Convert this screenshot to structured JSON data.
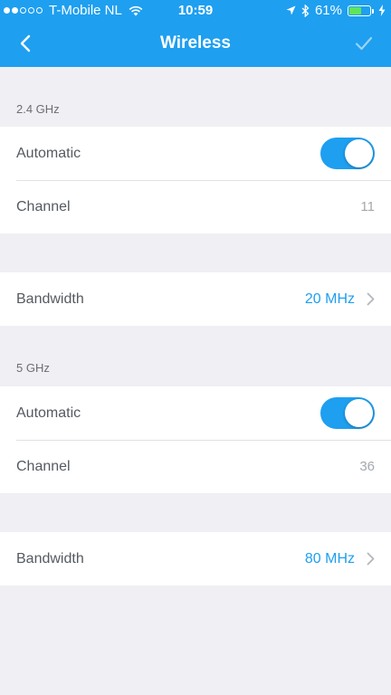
{
  "status_bar": {
    "carrier": "T-Mobile NL",
    "time": "10:59",
    "battery_percent": "61%",
    "battery_level": 0.61,
    "icons": [
      "signal-dots-icon",
      "wifi-icon",
      "location-arrow-icon",
      "bluetooth-icon",
      "battery-icon",
      "charging-bolt-icon"
    ]
  },
  "nav": {
    "title": "Wireless",
    "back_icon": "chevron-left-icon",
    "confirm_icon": "checkmark-icon"
  },
  "band_24": {
    "header": "2.4 GHz",
    "automatic_label": "Automatic",
    "automatic_on": true,
    "channel_label": "Channel",
    "channel_value": "11",
    "bandwidth_label": "Bandwidth",
    "bandwidth_value": "20 MHz"
  },
  "band_5": {
    "header": "5 GHz",
    "automatic_label": "Automatic",
    "automatic_on": true,
    "channel_label": "Channel",
    "channel_value": "36",
    "bandwidth_label": "Bandwidth",
    "bandwidth_value": "80 MHz"
  },
  "colors": {
    "accent": "#1e9ff0",
    "background": "#efeff4",
    "label_text": "#555a60",
    "muted_text": "#a5a9ae"
  }
}
